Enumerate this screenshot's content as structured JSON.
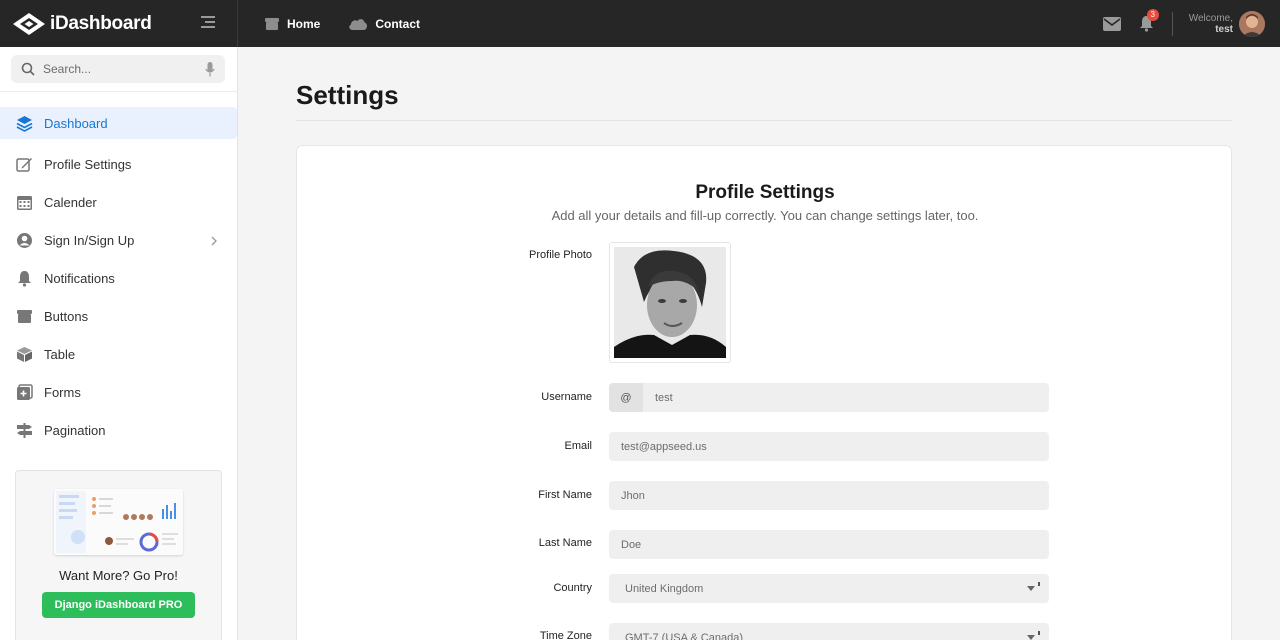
{
  "brand": {
    "name": "iDashboard"
  },
  "topnav": [
    {
      "label": "Home",
      "icon": "box-icon"
    },
    {
      "label": "Contact",
      "icon": "cloud-icon"
    }
  ],
  "user": {
    "welcome": "Welcome,",
    "username": "test",
    "notification_count": "3"
  },
  "search": {
    "placeholder": "Search..."
  },
  "sidebar": {
    "items": [
      {
        "label": "Dashboard",
        "icon": "layers-icon",
        "active": true
      },
      {
        "label": "Profile Settings",
        "icon": "edit-icon"
      },
      {
        "label": "Calender",
        "icon": "calendar-icon"
      },
      {
        "label": "Sign In/Sign Up",
        "icon": "user-circle-icon",
        "has_submenu": true
      },
      {
        "label": "Notifications",
        "icon": "bell-icon"
      },
      {
        "label": "Buttons",
        "icon": "box-icon"
      },
      {
        "label": "Table",
        "icon": "cube-icon"
      },
      {
        "label": "Forms",
        "icon": "plus-square-icon"
      },
      {
        "label": "Pagination",
        "icon": "signpost-icon"
      }
    ],
    "promo": {
      "title": "Want More? Go Pro!",
      "button": "Django iDashboard PRO"
    }
  },
  "page": {
    "title": "Settings"
  },
  "profile": {
    "title": "Profile Settings",
    "subtitle": "Add all your details and fill-up correctly. You can change settings later, too.",
    "photo_label": "Profile Photo",
    "fields": {
      "username": {
        "label": "Username",
        "addon": "@",
        "value": "test"
      },
      "email": {
        "label": "Email",
        "value": "test@appseed.us"
      },
      "first_name": {
        "label": "First Name",
        "value": "Jhon"
      },
      "last_name": {
        "label": "Last Name",
        "value": "Doe"
      },
      "country": {
        "label": "Country",
        "value": "United Kingdom"
      },
      "time_zone": {
        "label": "Time Zone",
        "value": "GMT-7 (USA & Canada)"
      }
    }
  },
  "colors": {
    "topbar": "#262626",
    "accent": "#1877d6",
    "pro_button": "#2dbd5a",
    "badge": "#e74c3c"
  }
}
